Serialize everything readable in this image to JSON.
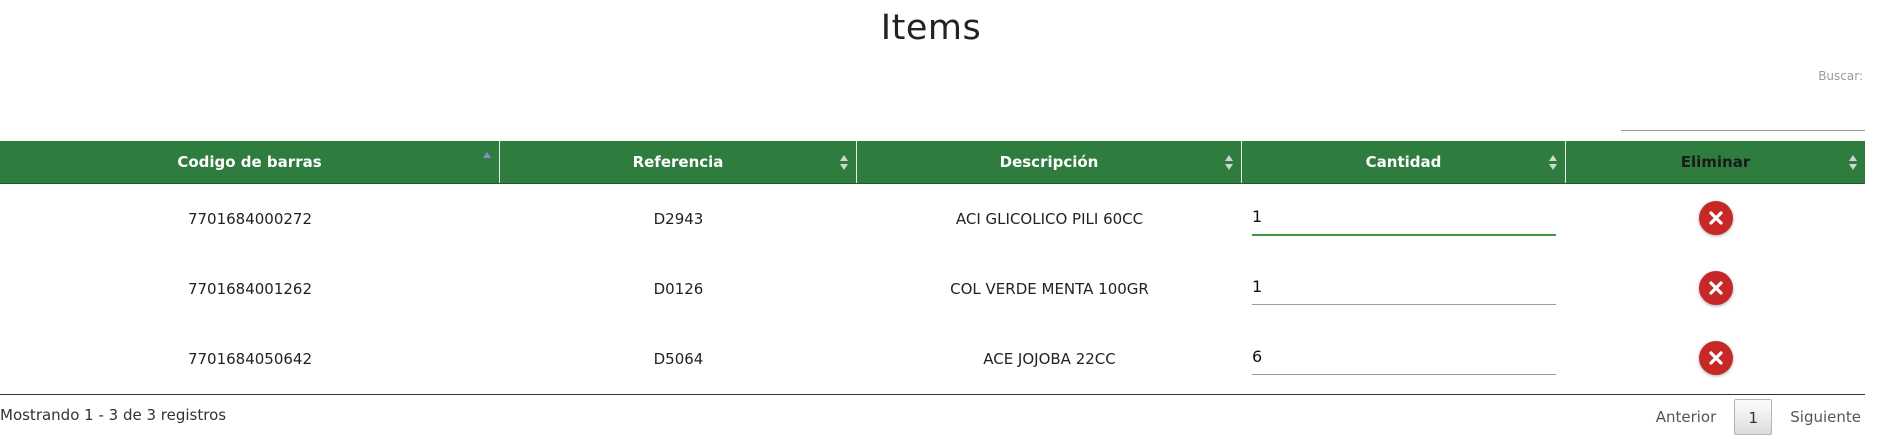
{
  "page": {
    "title": "Items"
  },
  "search": {
    "label": "Buscar:",
    "value": ""
  },
  "table": {
    "headers": [
      {
        "label": "Codigo de barras",
        "sort": "asc"
      },
      {
        "label": "Referencia",
        "sort": "both"
      },
      {
        "label": "Descripción",
        "sort": "both"
      },
      {
        "label": "Cantidad",
        "sort": "both"
      },
      {
        "label": "Eliminar",
        "sort": "both"
      }
    ],
    "rows": [
      {
        "barcode": "7701684000272",
        "reference": "D2943",
        "description": "ACI GLICOLICO PILI 60CC",
        "quantity": "1"
      },
      {
        "barcode": "7701684001262",
        "reference": "D0126",
        "description": "COL VERDE MENTA 100GR",
        "quantity": "1"
      },
      {
        "barcode": "7701684050642",
        "reference": "D5064",
        "description": "ACE JOJOBA 22CC",
        "quantity": "6"
      }
    ],
    "delete_icon": "close-icon",
    "colors": {
      "header_bg": "#2e7d3e",
      "delete_bg": "#c62828",
      "focus_line": "#3a9a44"
    }
  },
  "footer": {
    "info": "Mostrando 1 - 3 de 3 registros",
    "prev_label": "Anterior",
    "current_page": "1",
    "next_label": "Siguiente"
  }
}
